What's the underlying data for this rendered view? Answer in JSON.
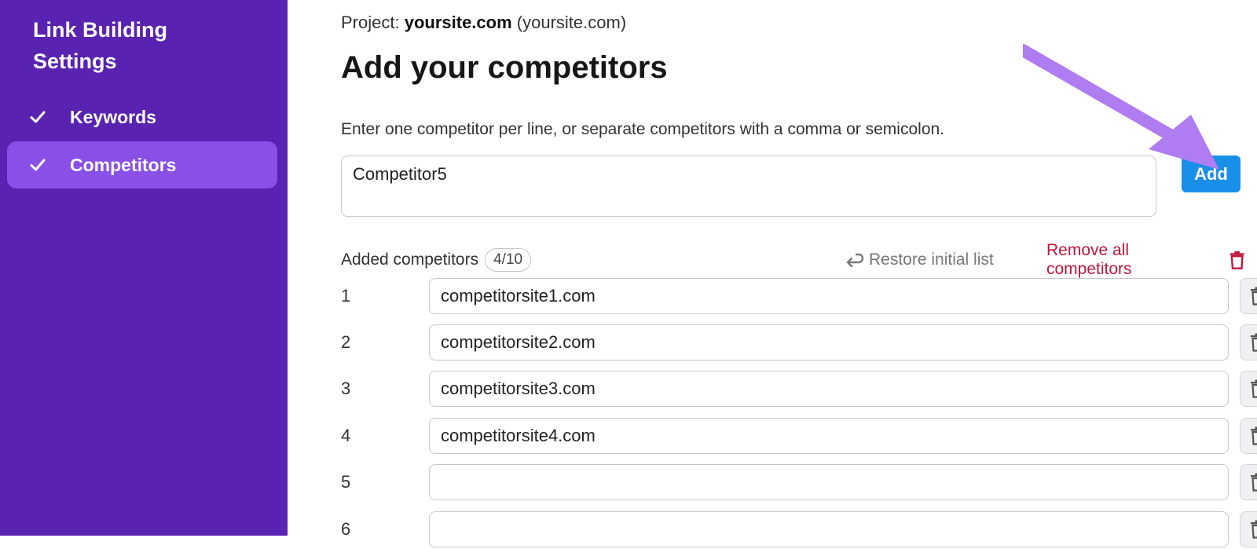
{
  "sidebar": {
    "title_line1": "Link Building",
    "title_line2": "Settings",
    "items": [
      {
        "label": "Keywords",
        "icon": "check-icon",
        "active": false
      },
      {
        "label": "Competitors",
        "icon": "check-icon",
        "active": true
      }
    ]
  },
  "header": {
    "project_prefix": "Project:",
    "project_name": "yoursite.com",
    "project_domain": "(yoursite.com)",
    "title": "Add your competitors"
  },
  "input": {
    "helper": "Enter one competitor per line, or separate competitors with a comma or semicolon.",
    "value": "Competitor5",
    "add_label": "Add"
  },
  "list": {
    "label": "Added competitors",
    "count": "4/10",
    "restore_label": "Restore initial list",
    "remove_all_label": "Remove all competitors",
    "rows": [
      {
        "num": "1",
        "value": "competitorsite1.com"
      },
      {
        "num": "2",
        "value": "competitorsite2.com"
      },
      {
        "num": "3",
        "value": "competitorsite3.com"
      },
      {
        "num": "4",
        "value": "competitorsite4.com"
      },
      {
        "num": "5",
        "value": ""
      },
      {
        "num": "6",
        "value": ""
      }
    ]
  },
  "colors": {
    "sidebar_bg": "#5a22b0",
    "sidebar_active": "#8a4fe6",
    "add_button": "#1a8fe8",
    "remove_red": "#c0163b",
    "annotation_arrow": "#b07cf2"
  }
}
